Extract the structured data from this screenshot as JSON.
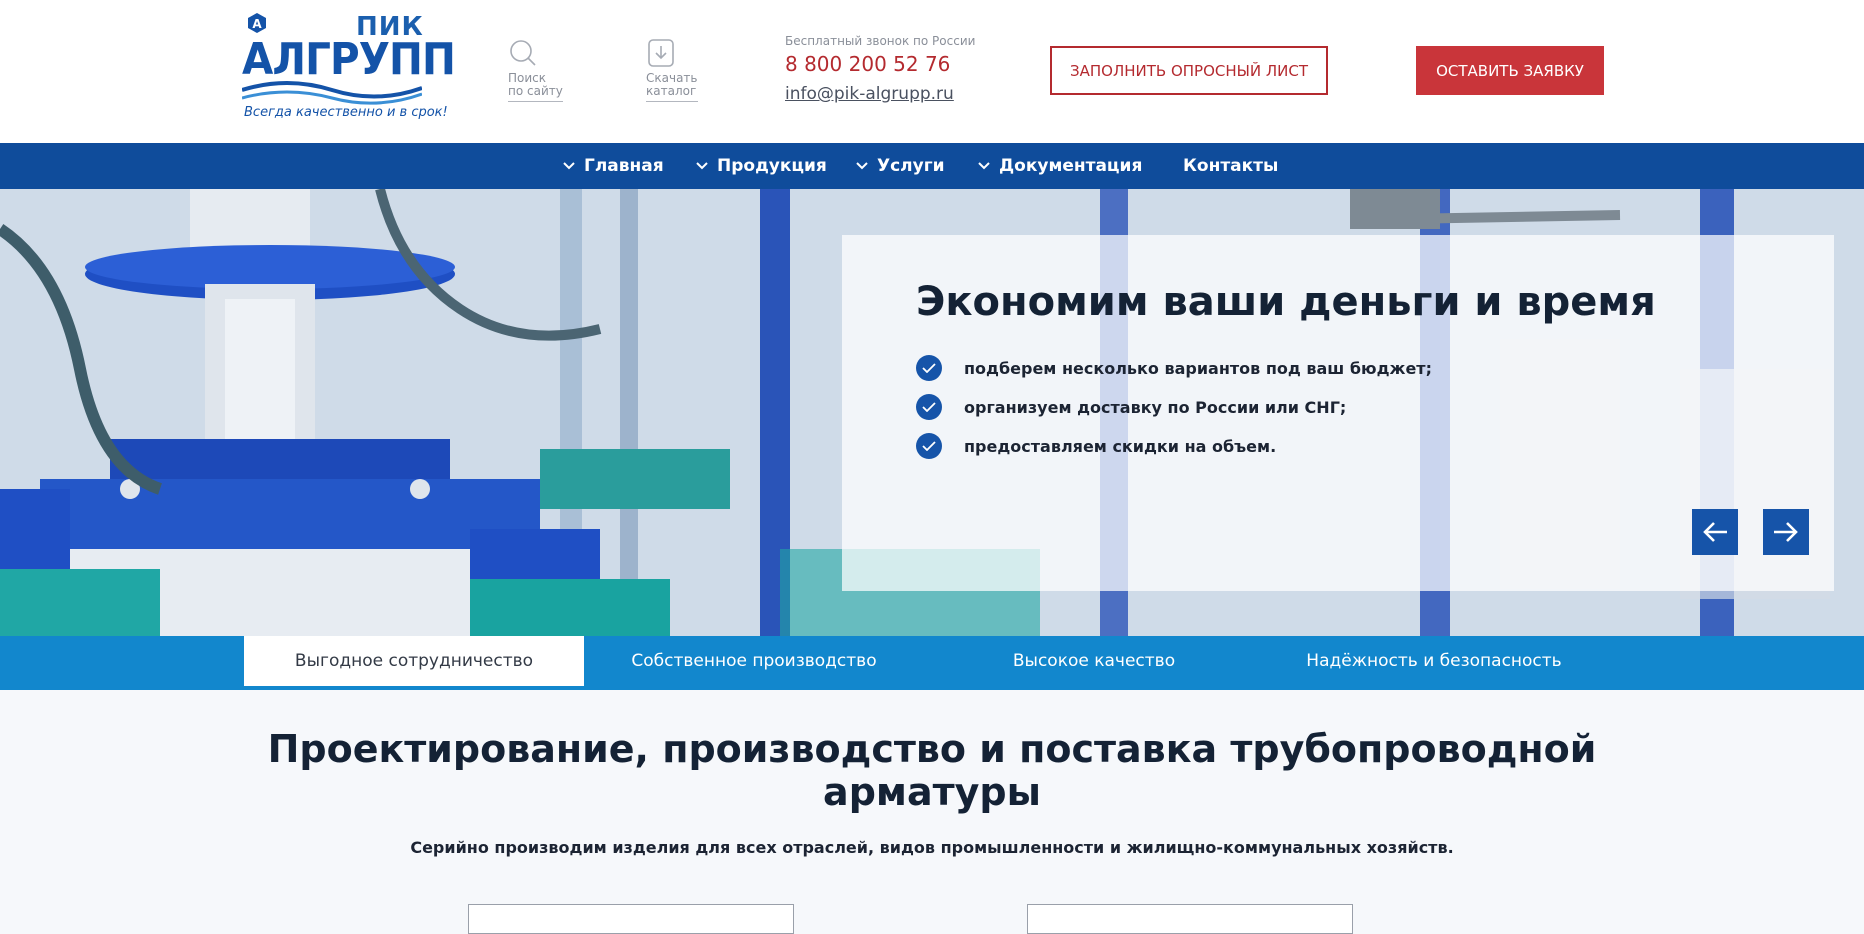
{
  "header": {
    "logo": {
      "brand_top": "ПИК",
      "brand_main": "АЛГРУПП",
      "tagline": "Всегда качественно и в срок!"
    },
    "search_link": {
      "line1": "Поиск",
      "line2": "по сайту",
      "icon": "search-icon"
    },
    "catalog_link": {
      "line1": "Скачать",
      "line2": "каталог",
      "icon": "download-icon"
    },
    "contacts": {
      "free_call_label": "Бесплатный звонок по России",
      "phone": "8 800 200 52 76",
      "email": "info@pik-algrupp.ru"
    },
    "questionnaire_button": "ЗАПОЛНИТЬ ОПРОСНЫЙ ЛИСТ",
    "request_button": "ОСТАВИТЬ ЗАЯВКУ"
  },
  "nav": {
    "items": [
      {
        "label": "Главная",
        "has_dropdown": true
      },
      {
        "label": "Продукция",
        "has_dropdown": true
      },
      {
        "label": "Услуги",
        "has_dropdown": true
      },
      {
        "label": "Документация",
        "has_dropdown": true
      },
      {
        "label": "Контакты",
        "has_dropdown": false
      }
    ]
  },
  "hero": {
    "title": "Экономим ваши деньги и время",
    "bullets": [
      "подберем несколько вариантов под ваш бюджет;",
      "организуем доставку по России или СНГ;",
      "предоставляем скидки на объем."
    ],
    "prev_icon": "arrow-left-icon",
    "next_icon": "arrow-right-icon"
  },
  "tabs": {
    "items": [
      {
        "label": "Выгодное сотрудничество",
        "active": true
      },
      {
        "label": "Собственное производство",
        "active": false
      },
      {
        "label": "Высокое качество",
        "active": false
      },
      {
        "label": "Надёжность и безопасность",
        "active": false
      }
    ]
  },
  "main": {
    "title_line1": "Проектирование, производство и поставка трубопроводной",
    "title_line2": "арматуры",
    "subtitle": "Серийно производим изделия для всех отраслей, видов промышленности и жилищно-коммунальных хозяйств."
  },
  "colors": {
    "brand_blue": "#0f4c9b",
    "tab_blue": "#1287cd",
    "accent_red": "#c9353a"
  }
}
